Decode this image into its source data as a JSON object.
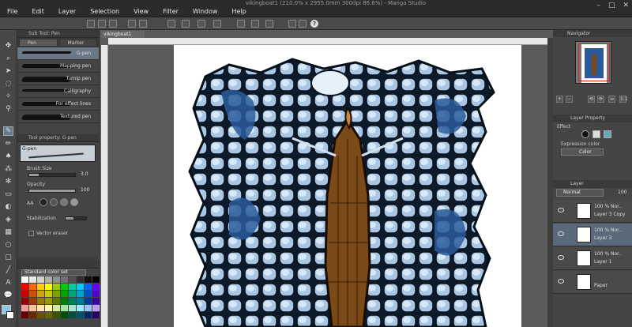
{
  "app": {
    "window_title": "vikingboat1 (210.0% x 2955.0mm 300dpi 86.6%) - Manga Studio"
  },
  "menu": [
    "File",
    "Edit",
    "Layer",
    "Selection",
    "View",
    "Filter",
    "Window",
    "Help"
  ],
  "window_controls": [
    "minimize-icon",
    "maximize-icon",
    "close-icon"
  ],
  "document": {
    "tab_label": "vikingboat1"
  },
  "sub_tool": {
    "header": "Sub Tool: Pen",
    "tabs": [
      "Pen",
      "Marker"
    ],
    "brushes": [
      {
        "label": "G-pen",
        "active": true
      },
      {
        "label": "Mapping pen",
        "active": false
      },
      {
        "label": "Turnip pen",
        "active": false
      },
      {
        "label": "Calligraphy",
        "active": false
      },
      {
        "label": "For effect lines",
        "active": false
      },
      {
        "label": "Textured pen",
        "active": false
      }
    ]
  },
  "tool_property": {
    "header": "Tool property: G-pen",
    "preset": "G-pen",
    "brush_size_label": "Brush Size",
    "brush_size_value": "3.0",
    "opacity_label": "Opacity",
    "opacity_value": "100",
    "aa_label": "AA",
    "stabilization_label": "Stabilization",
    "vector_eraser_label": "Vector eraser",
    "brush_size_fraction": 0.2,
    "opacity_fraction": 1.0
  },
  "color_set": {
    "header": "Standard color set",
    "swatches": [
      "#ffffff",
      "#e8e8e8",
      "#d0d0d0",
      "#b0b0b0",
      "#909090",
      "#707070",
      "#505050",
      "#303030",
      "#101010",
      "#000000",
      "#ff0000",
      "#ff6600",
      "#ffcc00",
      "#ffff00",
      "#99cc00",
      "#00cc00",
      "#00cc99",
      "#00ccff",
      "#0066ff",
      "#6600ff",
      "#cc0000",
      "#cc5200",
      "#cca300",
      "#cccc00",
      "#7aa300",
      "#00a300",
      "#00a37a",
      "#00a3cc",
      "#0052cc",
      "#5200cc",
      "#990000",
      "#993d00",
      "#997a00",
      "#999900",
      "#5c7a00",
      "#007a00",
      "#007a5c",
      "#007a99",
      "#003d99",
      "#3d0099",
      "#ff9999",
      "#ffc299",
      "#ffe699",
      "#ffff99",
      "#d6eb99",
      "#99eb99",
      "#99ebd6",
      "#99ebff",
      "#99c2ff",
      "#c299ff",
      "#660000",
      "#662900",
      "#665200",
      "#666600",
      "#3d5200",
      "#005200",
      "#00523d",
      "#005266",
      "#002966",
      "#290066"
    ]
  },
  "navigator": {
    "header": "Navigator",
    "zoom_buttons": [
      "+",
      "-",
      "⟲",
      "⟳",
      "↔",
      "1:1"
    ]
  },
  "layer_property": {
    "header": "Layer Property",
    "effect_label": "Effect",
    "expression_label": "Expression color",
    "expression_value": "Color"
  },
  "layers": {
    "header": "Layer",
    "blend_mode": "Normal",
    "opacity": "100",
    "items": [
      {
        "mode": "100 %  Nor..",
        "name": "Layer 3 Copy",
        "active": false
      },
      {
        "mode": "100 %  Nor..",
        "name": "Layer 3",
        "active": true
      },
      {
        "mode": "100 %  Nor..",
        "name": "Layer 1",
        "active": false
      },
      {
        "mode": "",
        "name": "Paper",
        "active": false
      }
    ]
  },
  "colors": {
    "accent": "#6a7886",
    "canvas_bg": "#5a5a5a",
    "paper": "#ffffff"
  }
}
